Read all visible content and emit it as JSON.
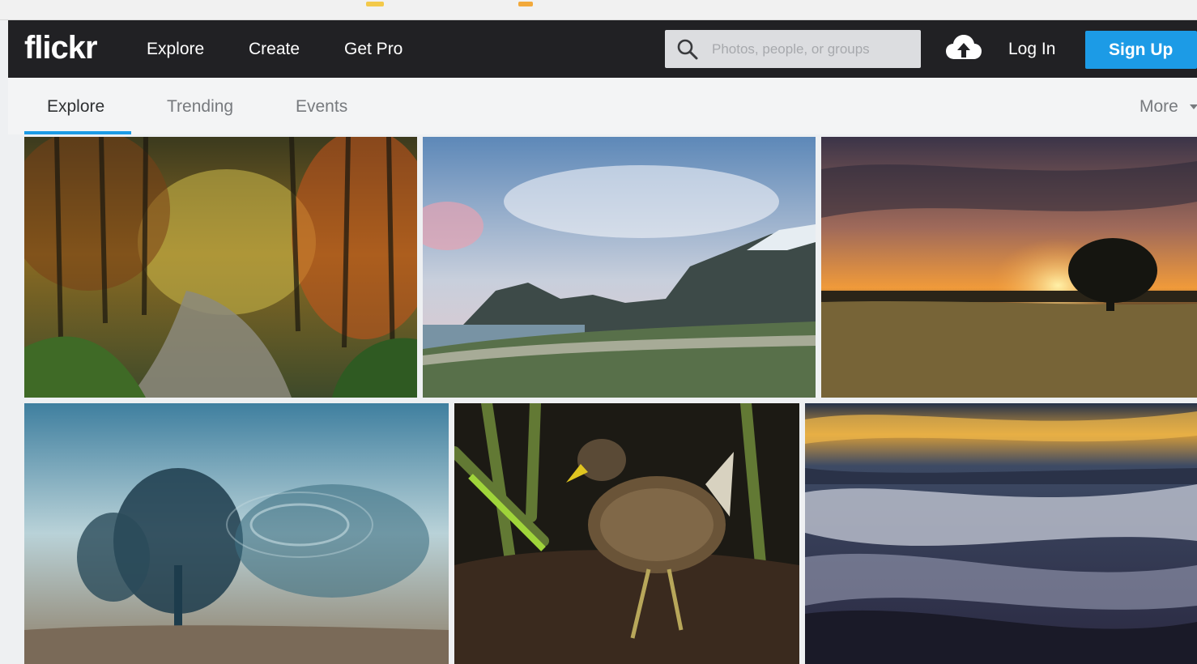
{
  "brand": {
    "logo_text": "flickr"
  },
  "header": {
    "nav": [
      "Explore",
      "Create",
      "Get Pro"
    ],
    "search": {
      "placeholder": "Photos, people, or groups",
      "value": ""
    },
    "login_label": "Log In",
    "signup_label": "Sign Up"
  },
  "subnav": {
    "tabs": [
      "Explore",
      "Trending",
      "Events"
    ],
    "active_tab": "Explore",
    "more_label": "More"
  },
  "colors": {
    "topbar": "#212124",
    "accent": "#1c9be6",
    "subnav": "#f3f4f5"
  },
  "icons": [
    "search-icon",
    "upload-cloud-icon",
    "chevron-down-icon"
  ],
  "photos": [
    {
      "subject": "autumn-forest-stream"
    },
    {
      "subject": "beach-with-mountains"
    },
    {
      "subject": "sunset-tree-field"
    },
    {
      "subject": "blurred-trees-reflection"
    },
    {
      "subject": "bird-in-reeds"
    },
    {
      "subject": "sea-waves-at-sunset"
    }
  ]
}
